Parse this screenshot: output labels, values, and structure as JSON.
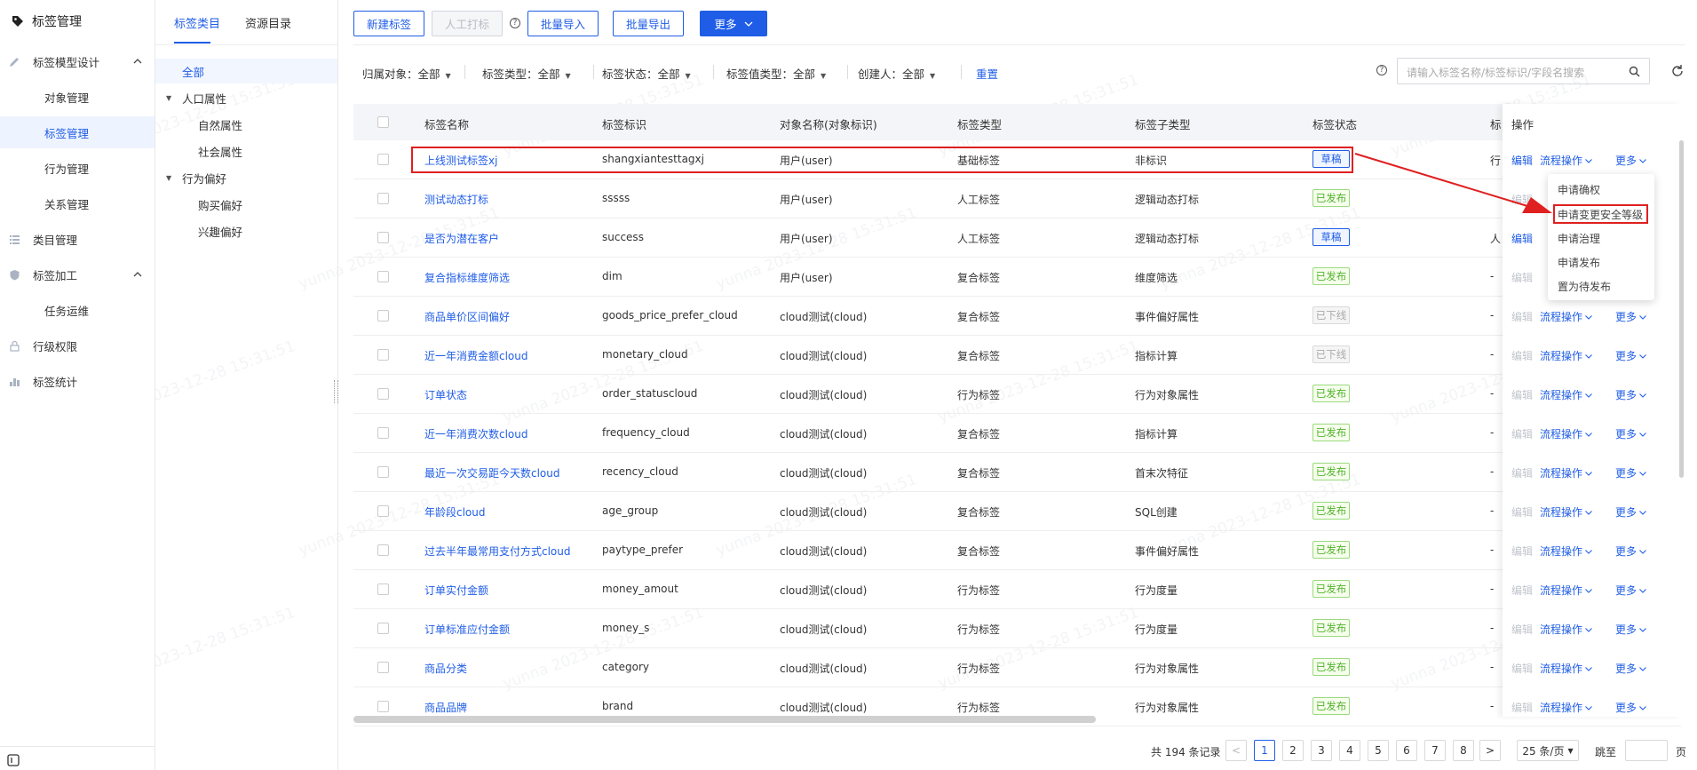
{
  "app": {
    "title": "标签管理"
  },
  "nav": {
    "items": [
      {
        "label": "标签模型设计",
        "type": "group"
      },
      {
        "label": "对象管理",
        "type": "child"
      },
      {
        "label": "标签管理",
        "type": "child"
      },
      {
        "label": "行为管理",
        "type": "child"
      },
      {
        "label": "关系管理",
        "type": "child"
      },
      {
        "label": "类目管理",
        "type": "top"
      },
      {
        "label": "标签加工",
        "type": "group"
      },
      {
        "label": "任务运维",
        "type": "child"
      },
      {
        "label": "行级权限",
        "type": "top"
      },
      {
        "label": "标签统计",
        "type": "top"
      }
    ]
  },
  "catalog": {
    "tabs": [
      "标签类目",
      "资源目录"
    ],
    "tree": [
      "全部",
      "人口属性",
      "自然属性",
      "社会属性",
      "行为偏好",
      "购买偏好",
      "兴趣偏好"
    ]
  },
  "toolbar": {
    "new_label": "新建标签",
    "manual_label": "人工打标",
    "import_label": "批量导入",
    "export_label": "批量导出",
    "more_label": "更多"
  },
  "filters": [
    {
      "label": "归属对象：",
      "value": "全部"
    },
    {
      "label": "标签类型：",
      "value": "全部"
    },
    {
      "label": "标签状态：",
      "value": "全部"
    },
    {
      "label": "标签值类型：",
      "value": "全部"
    },
    {
      "label": "创建人：",
      "value": "全部"
    }
  ],
  "filters_reset": "重置",
  "search": {
    "placeholder": "请输入标签名称/标签标识/字段名搜索"
  },
  "table": {
    "headers": [
      "标签名称",
      "标签标识",
      "对象名称(对象标识)",
      "标签类型",
      "标签子类型",
      "标签状态",
      "标",
      "操作"
    ],
    "rows": [
      {
        "name": "上线测试标签xj",
        "code": "shangxiantesttagxj",
        "obj": "用户(user)",
        "type": "基础标签",
        "sub": "非标识",
        "status": "草稿",
        "extra": "行"
      },
      {
        "name": "测试动态打标",
        "code": "sssss",
        "obj": "用户(user)",
        "type": "人工标签",
        "sub": "逻辑动态打标",
        "status": "已发布",
        "extra": ""
      },
      {
        "name": "是否为潜在客户",
        "code": "success",
        "obj": "用户(user)",
        "type": "人工标签",
        "sub": "逻辑动态打标",
        "status": "草稿",
        "extra": "人"
      },
      {
        "name": "复合指标维度筛选",
        "code": "dim",
        "obj": "用户(user)",
        "type": "复合标签",
        "sub": "维度筛选",
        "status": "已发布",
        "extra": "-"
      },
      {
        "name": "商品单价区间偏好",
        "code": "goods_price_prefer_cloud",
        "obj": "cloud测试(cloud)",
        "type": "复合标签",
        "sub": "事件偏好属性",
        "status": "已下线",
        "extra": "-"
      },
      {
        "name": "近一年消费金额cloud",
        "code": "monetary_cloud",
        "obj": "cloud测试(cloud)",
        "type": "复合标签",
        "sub": "指标计算",
        "status": "已下线",
        "extra": "-"
      },
      {
        "name": "订单状态",
        "code": "order_statuscloud",
        "obj": "cloud测试(cloud)",
        "type": "行为标签",
        "sub": "行为对象属性",
        "status": "已发布",
        "extra": "-"
      },
      {
        "name": "近一年消费次数cloud",
        "code": "frequency_cloud",
        "obj": "cloud测试(cloud)",
        "type": "复合标签",
        "sub": "指标计算",
        "status": "已发布",
        "extra": "-"
      },
      {
        "name": "最近一次交易距今天数cloud",
        "code": "recency_cloud",
        "obj": "cloud测试(cloud)",
        "type": "复合标签",
        "sub": "首末次特征",
        "status": "已发布",
        "extra": "-"
      },
      {
        "name": "年龄段cloud",
        "code": "age_group",
        "obj": "cloud测试(cloud)",
        "type": "复合标签",
        "sub": "SQL创建",
        "status": "已发布",
        "extra": "-"
      },
      {
        "name": "过去半年最常用支付方式cloud",
        "code": "paytype_prefer",
        "obj": "cloud测试(cloud)",
        "type": "复合标签",
        "sub": "事件偏好属性",
        "status": "已发布",
        "extra": "-"
      },
      {
        "name": "订单实付金额",
        "code": "money_amout",
        "obj": "cloud测试(cloud)",
        "type": "行为标签",
        "sub": "行为度量",
        "status": "已发布",
        "extra": "-"
      },
      {
        "name": "订单标准应付金额",
        "code": "money_s",
        "obj": "cloud测试(cloud)",
        "type": "行为标签",
        "sub": "行为度量",
        "status": "已发布",
        "extra": "-"
      },
      {
        "name": "商品分类",
        "code": "category",
        "obj": "cloud测试(cloud)",
        "type": "行为标签",
        "sub": "行为对象属性",
        "status": "已发布",
        "extra": "-"
      },
      {
        "name": "商品品牌",
        "code": "brand",
        "obj": "cloud测试(cloud)",
        "type": "行为标签",
        "sub": "行为对象属性",
        "status": "已发布",
        "extra": "-"
      }
    ]
  },
  "ops": {
    "edit": "编辑",
    "flow": "流程操作",
    "more": "更多"
  },
  "menu": [
    "申请确权",
    "申请变更安全等级",
    "申请治理",
    "申请发布",
    "置为待发布"
  ],
  "pagination": {
    "total": "共 194 条记录",
    "pages": [
      "1",
      "2",
      "3",
      "4",
      "5",
      "6",
      "7",
      "8"
    ],
    "size": "25 条/页",
    "goto": "跳至",
    "page_unit": "页"
  },
  "watermark": "yunna 2023-12-28 15:31:51",
  "colors": {
    "primary": "#1f5de6",
    "published": "#52b22b",
    "highlight": "#e02020"
  }
}
